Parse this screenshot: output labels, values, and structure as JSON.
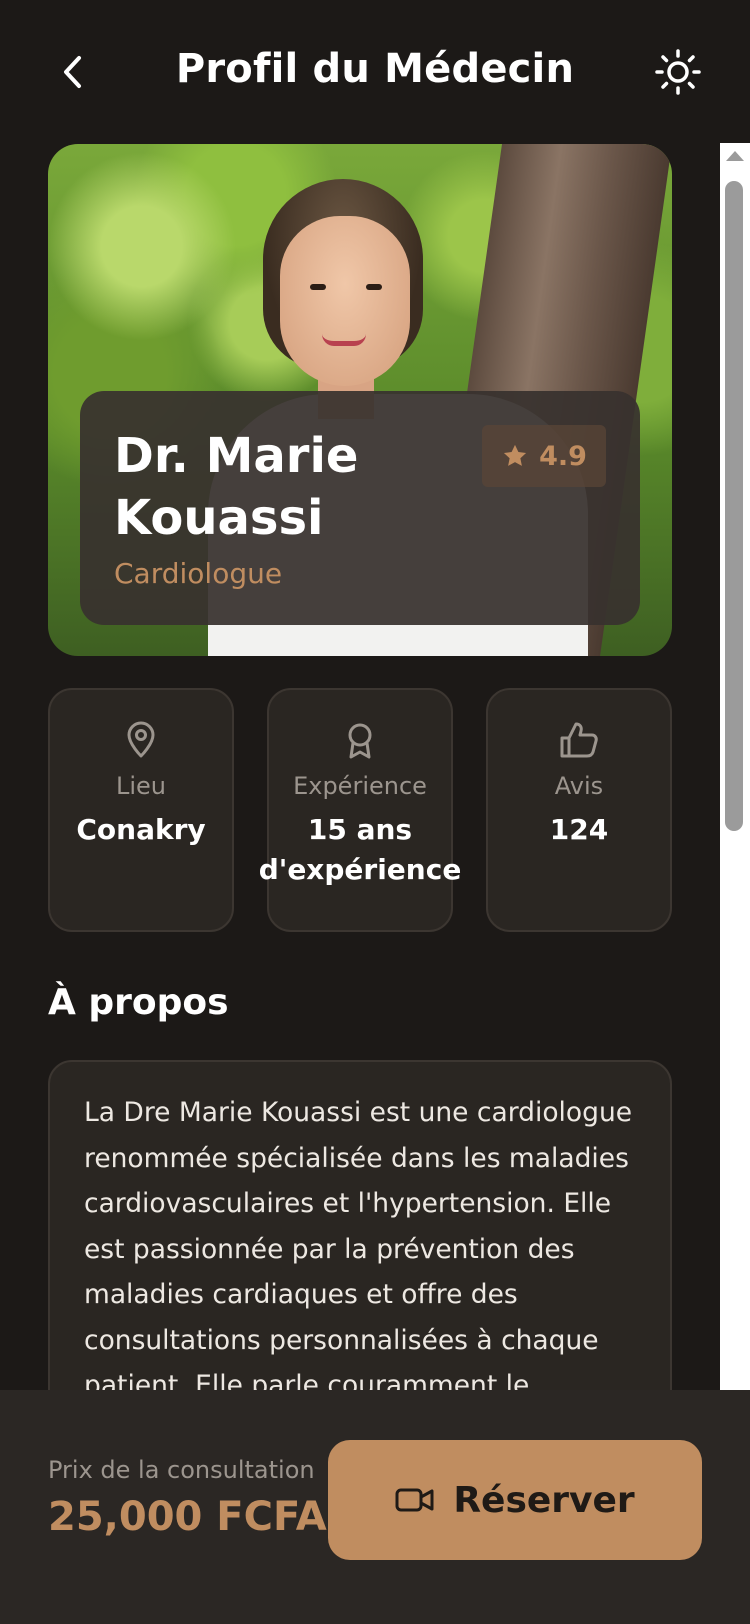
{
  "header": {
    "title": "Profil du Médecin",
    "back_icon": "chevron-left-icon",
    "theme_icon": "sun-icon"
  },
  "doctor": {
    "name": "Dr. Marie Kouassi",
    "specialty": "Cardiologue",
    "rating": "4.9",
    "rating_icon": "star-icon"
  },
  "stats": [
    {
      "icon": "map-pin-icon",
      "label": "Lieu",
      "value": "Conakry"
    },
    {
      "icon": "award-icon",
      "label": "Expérience",
      "value": "15 ans d'expérience"
    },
    {
      "icon": "thumbs-up-icon",
      "label": "Avis",
      "value": "124"
    }
  ],
  "about": {
    "title": "À propos",
    "text": "La Dre Marie Kouassi est une cardiologue renommée spécialisée dans les maladies cardiovasculaires et l'hypertension. Elle est passionnée par la prévention des maladies cardiaques et offre des consultations personnalisées à chaque patient. Elle parle couramment le français"
  },
  "booking": {
    "price_label": "Prix de la consultation",
    "price": "25,000 FCFA",
    "button_label": "Réserver",
    "button_icon": "video-camera-icon"
  },
  "colors": {
    "background": "#1c1917",
    "card": "#2a2622",
    "accent": "#c08d60",
    "bottom_bar": "#2b2724"
  }
}
